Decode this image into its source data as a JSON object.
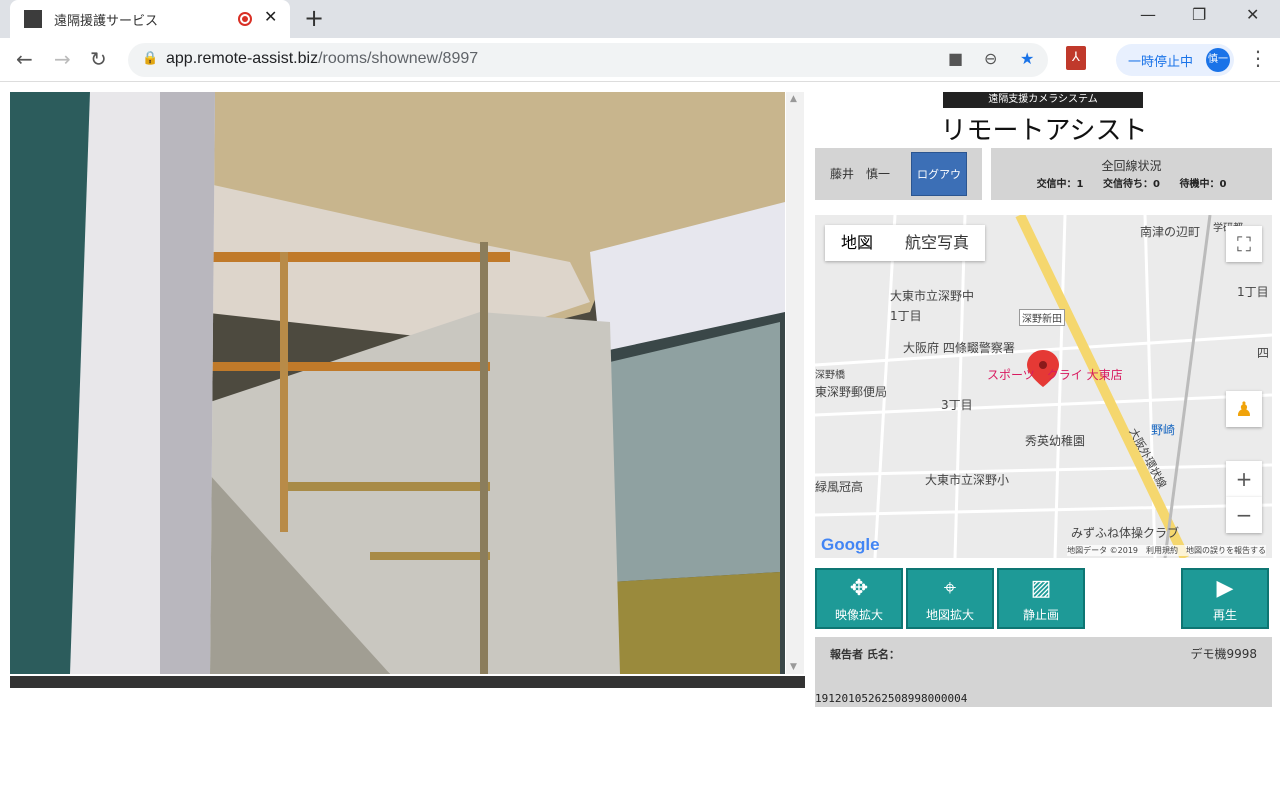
{
  "browser": {
    "tab_title": "遠隔援護サービス",
    "new_tab": "+",
    "url_host": "app.remote-assist.biz",
    "url_path": "/rooms/shownew/8997",
    "pause_label": "一時停止中",
    "avatar_text": "慎一"
  },
  "header": {
    "brand_sub": "遠隔支援カメラシステム",
    "brand_title": "リモートアシスト"
  },
  "user": {
    "name": "藤井　慎一",
    "logout_label": "ログアウト"
  },
  "line_status": {
    "title": "全回線状況",
    "in_call": "交信中：1",
    "waiting": "交信待ち：0",
    "standby": "待機中：0"
  },
  "map": {
    "tab_map": "地図",
    "tab_aerial": "航空写真",
    "labels": {
      "minamitsu": "南津の辺町",
      "gakken": "学研都",
      "daito_jhs": "大東市立深野中",
      "chome1": "1丁目",
      "chome1b": "1丁目",
      "fukano_shinden": "深野新田",
      "police": "大阪府 四條畷警察署",
      "fukanobashi": "深野橋",
      "post": "東深野郵便局",
      "sports": "スポーツ　クライ 大東店",
      "chome3": "3丁目",
      "nozaki": "野崎",
      "kindergarten": "秀英幼稚園",
      "road": "大阪外環状線",
      "fukano_es": "大東市立深野小",
      "hs": "緑風冠高",
      "gym": "みずふね体操クラブ",
      "shi": "四"
    },
    "google": "Google",
    "attribution": "地図データ ©2019　利用規約　地図の誤りを報告する"
  },
  "buttons": {
    "video_zoom": "映像拡大",
    "map_zoom": "地図拡大",
    "still": "静止画",
    "play": "再生"
  },
  "report": {
    "label": "報告者 氏名：",
    "device": "デモ機9998",
    "id": "19120105262508998000004"
  }
}
